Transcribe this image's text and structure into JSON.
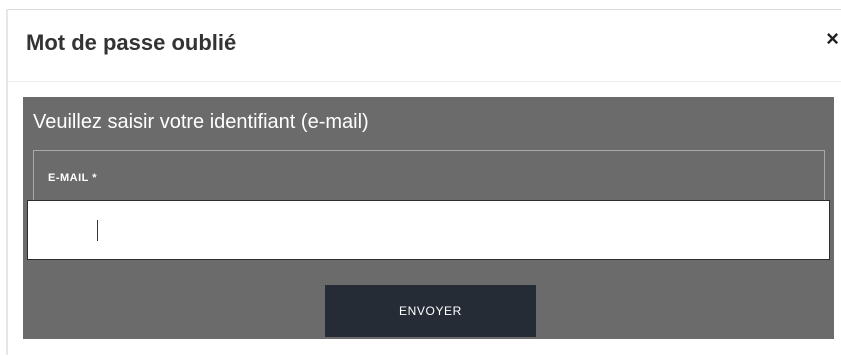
{
  "modal": {
    "title": "Mot de passe oublié",
    "close_glyph": "×"
  },
  "form": {
    "heading": "Veuillez saisir votre identifiant (e-mail)",
    "email_label": "E-MAIL *",
    "email_value": "",
    "submit_label": "ENVOYER"
  },
  "icons": {
    "close": "close-icon"
  },
  "colors": {
    "panel_bg": "#6b6b6b",
    "button_bg": "#252c36",
    "title_text": "#333333"
  }
}
